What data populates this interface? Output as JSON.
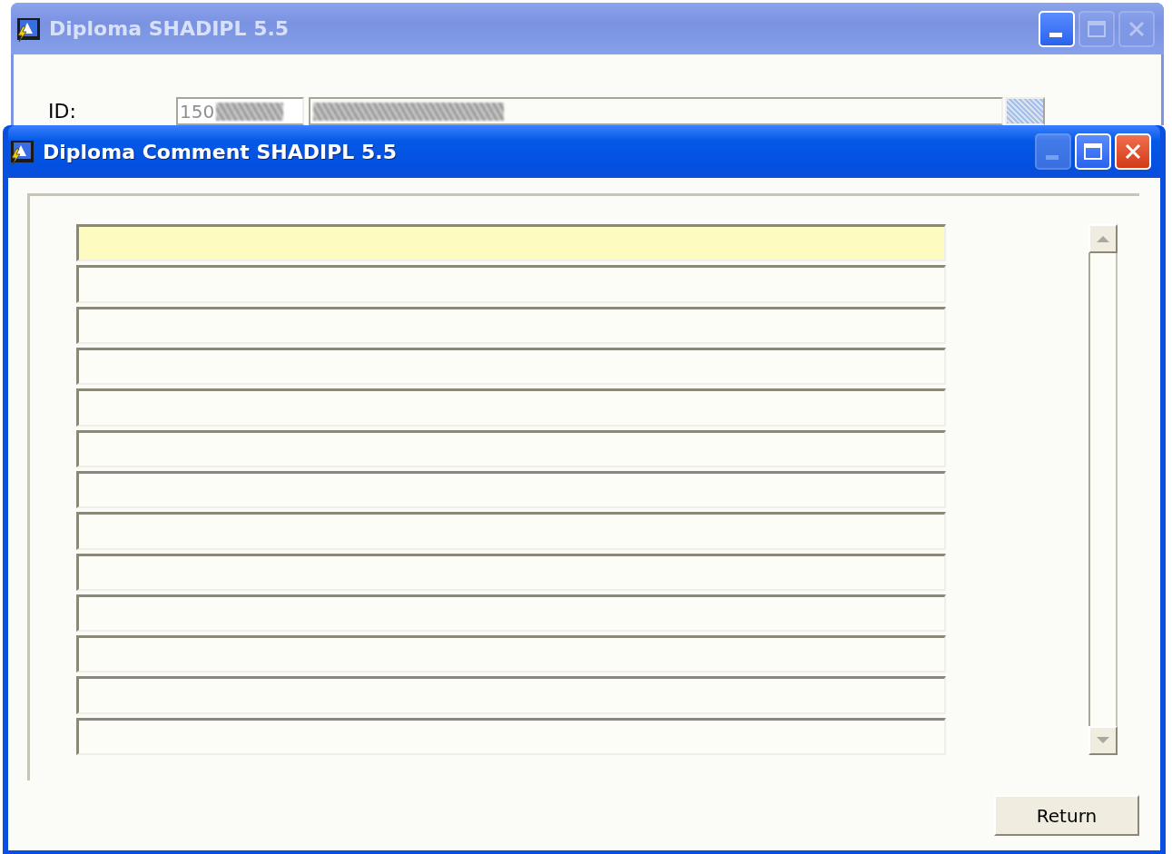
{
  "back_window": {
    "title": "Diploma  SHADIPL  5.5",
    "active": false,
    "title_buttons": [
      {
        "kind": "minimize",
        "disabled": false
      },
      {
        "kind": "maximize",
        "disabled": true
      },
      {
        "kind": "close",
        "disabled": true
      }
    ],
    "id_label": "ID:",
    "id_value": "150"
  },
  "front_window": {
    "title": "Diploma Comment  SHADIPL  5.5",
    "active": true,
    "title_buttons": [
      {
        "kind": "minimize",
        "disabled": true
      },
      {
        "kind": "maximize",
        "disabled": false
      },
      {
        "kind": "close",
        "disabled": false
      }
    ],
    "comment_rows": [
      {
        "selected": true
      },
      {
        "selected": false
      },
      {
        "selected": false
      },
      {
        "selected": false
      },
      {
        "selected": false
      },
      {
        "selected": false
      },
      {
        "selected": false
      },
      {
        "selected": false
      },
      {
        "selected": false
      },
      {
        "selected": false
      },
      {
        "selected": false
      },
      {
        "selected": false
      },
      {
        "selected": false
      }
    ],
    "button": "Return"
  }
}
